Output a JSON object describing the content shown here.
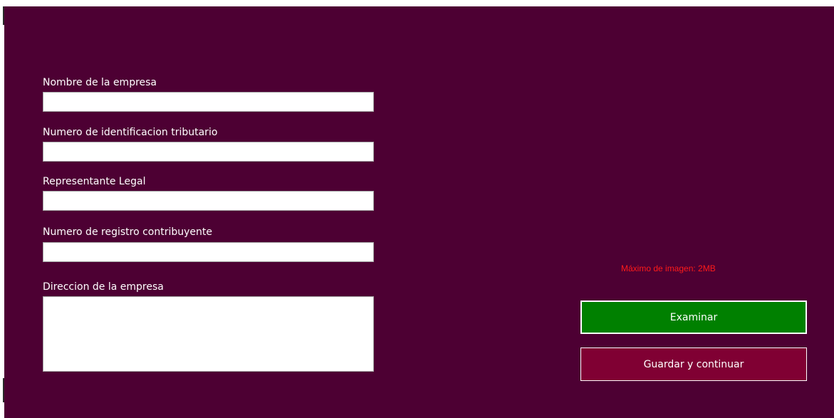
{
  "form": {
    "company_name": {
      "label": "Nombre de la empresa",
      "value": ""
    },
    "tax_id": {
      "label": "Numero de identificacion tributario",
      "value": ""
    },
    "legal_rep": {
      "label": "Representante Legal",
      "value": ""
    },
    "taxpayer_reg": {
      "label": "Numero de registro contribuyente",
      "value": ""
    },
    "address": {
      "label": "Direccion de la empresa",
      "value": ""
    }
  },
  "image": {
    "max_note": "Máximo de imagen: 2MB",
    "browse_label": "Examinar"
  },
  "actions": {
    "save_label": "Guardar y continuar"
  },
  "colors": {
    "background": "#4d0033",
    "browse_button": "#008000",
    "save_button": "#800033",
    "note_text": "#ff1a1a"
  }
}
